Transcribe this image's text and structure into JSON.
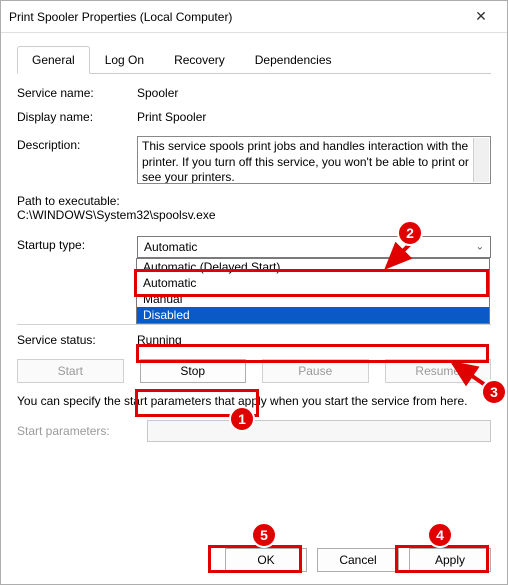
{
  "title": "Print Spooler Properties (Local Computer)",
  "tabs": [
    "General",
    "Log On",
    "Recovery",
    "Dependencies"
  ],
  "active_tab": 0,
  "labels": {
    "service_name": "Service name:",
    "display_name": "Display name:",
    "description": "Description:",
    "path": "Path to executable:",
    "startup_type": "Startup type:",
    "service_status": "Service status:",
    "start_parameters": "Start parameters:"
  },
  "values": {
    "service_name": "Spooler",
    "display_name": "Print Spooler",
    "description": "This service spools print jobs and handles interaction with the printer.  If you turn off this service, you won't be able to print or see your printers.",
    "path": "C:\\WINDOWS\\System32\\spoolsv.exe",
    "startup_selected": "Automatic",
    "service_status": "Running",
    "start_parameters": ""
  },
  "startup_options": [
    "Automatic (Delayed Start)",
    "Automatic",
    "Manual",
    "Disabled"
  ],
  "startup_highlight_index": 3,
  "buttons": {
    "start": "Start",
    "stop": "Stop",
    "pause": "Pause",
    "resume": "Resume",
    "ok": "OK",
    "cancel": "Cancel",
    "apply": "Apply"
  },
  "note": "You can specify the start parameters that apply when you start the service from here.",
  "annotations": {
    "1": "1",
    "2": "2",
    "3": "3",
    "4": "4",
    "5": "5"
  }
}
